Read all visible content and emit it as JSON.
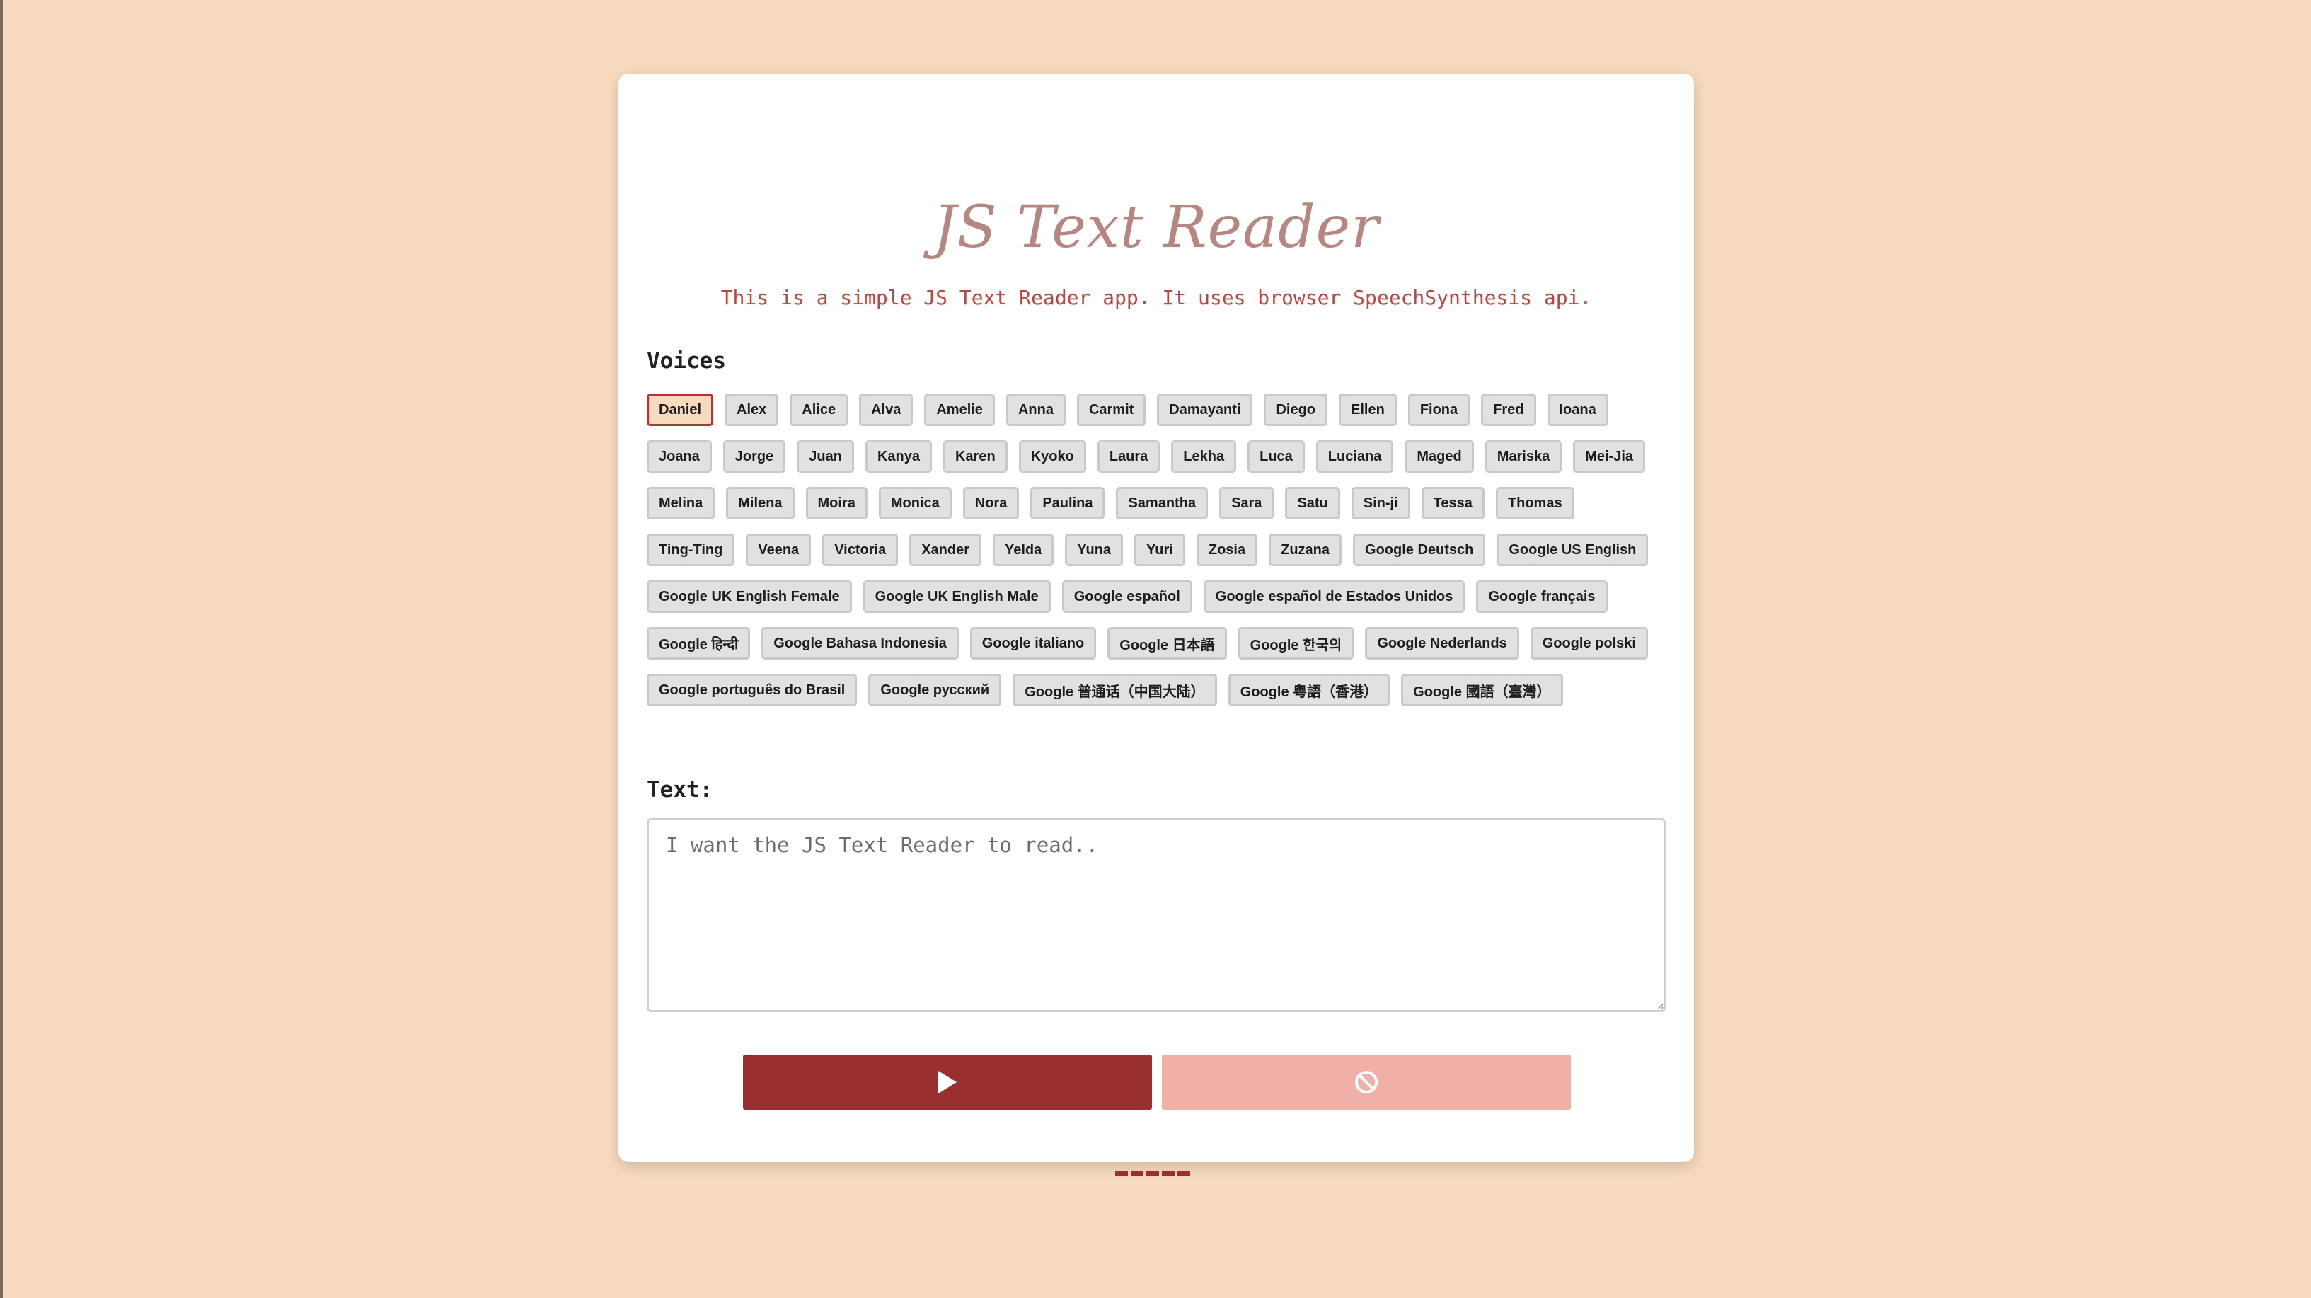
{
  "app": {
    "title": "JS Text Reader",
    "subtitle": "This is a simple JS Text Reader app. It uses browser SpeechSynthesis api."
  },
  "voices_section": {
    "label": "Voices",
    "selected": "Daniel",
    "items": [
      "Daniel",
      "Alex",
      "Alice",
      "Alva",
      "Amelie",
      "Anna",
      "Carmit",
      "Damayanti",
      "Diego",
      "Ellen",
      "Fiona",
      "Fred",
      "Ioana",
      "Joana",
      "Jorge",
      "Juan",
      "Kanya",
      "Karen",
      "Kyoko",
      "Laura",
      "Lekha",
      "Luca",
      "Luciana",
      "Maged",
      "Mariska",
      "Mei-Jia",
      "Melina",
      "Milena",
      "Moira",
      "Monica",
      "Nora",
      "Paulina",
      "Samantha",
      "Sara",
      "Satu",
      "Sin-ji",
      "Tessa",
      "Thomas",
      "Ting-Ting",
      "Veena",
      "Victoria",
      "Xander",
      "Yelda",
      "Yuna",
      "Yuri",
      "Zosia",
      "Zuzana",
      "Google Deutsch",
      "Google US English",
      "Google UK English Female",
      "Google UK English Male",
      "Google español",
      "Google español de Estados Unidos",
      "Google français",
      "Google हिन्दी",
      "Google Bahasa Indonesia",
      "Google italiano",
      "Google 日本語",
      "Google 한국의",
      "Google Nederlands",
      "Google polski",
      "Google português do Brasil",
      "Google русский",
      "Google 普通话（中国大陆）",
      "Google 粤語（香港）",
      "Google 國語（臺灣）"
    ]
  },
  "text_section": {
    "label": "Text:",
    "placeholder": "I want the JS Text Reader to read..",
    "value": ""
  },
  "controls": {
    "play_icon": "play-icon",
    "stop_icon": "cancel-icon",
    "play_color": "#992f2f",
    "stop_color": "#f0b0a8"
  },
  "colors": {
    "background": "#f8dbbf",
    "accent": "#992f2f",
    "title": "#b88680",
    "subtitle": "#c0453f",
    "selected_border": "#b9322f"
  }
}
